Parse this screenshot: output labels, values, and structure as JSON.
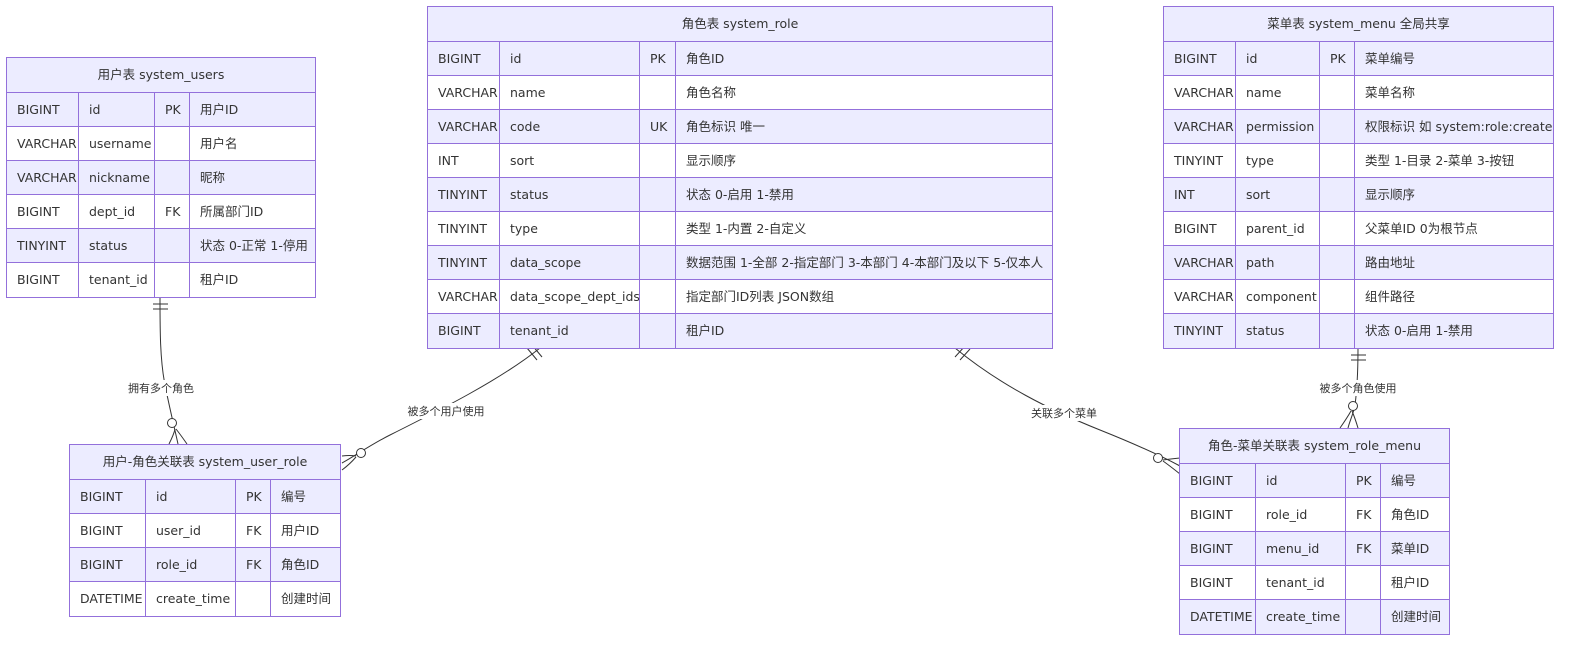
{
  "colors": {
    "border": "#9370db",
    "header_bg": "#ececff",
    "row_alt_bg": "#ececff",
    "line": "#333333"
  },
  "entities": {
    "system_users": {
      "title": "用户表 system_users",
      "rows": [
        {
          "type": "BIGINT",
          "name": "id",
          "key": "PK",
          "comment": "用户ID"
        },
        {
          "type": "VARCHAR",
          "name": "username",
          "key": "",
          "comment": "用户名"
        },
        {
          "type": "VARCHAR",
          "name": "nickname",
          "key": "",
          "comment": "昵称"
        },
        {
          "type": "BIGINT",
          "name": "dept_id",
          "key": "FK",
          "comment": "所属部门ID"
        },
        {
          "type": "TINYINT",
          "name": "status",
          "key": "",
          "comment": "状态 0-正常 1-停用"
        },
        {
          "type": "BIGINT",
          "name": "tenant_id",
          "key": "",
          "comment": "租户ID"
        }
      ]
    },
    "system_role": {
      "title": "角色表 system_role",
      "rows": [
        {
          "type": "BIGINT",
          "name": "id",
          "key": "PK",
          "comment": "角色ID"
        },
        {
          "type": "VARCHAR",
          "name": "name",
          "key": "",
          "comment": "角色名称"
        },
        {
          "type": "VARCHAR",
          "name": "code",
          "key": "UK",
          "comment": "角色标识 唯一"
        },
        {
          "type": "INT",
          "name": "sort",
          "key": "",
          "comment": "显示顺序"
        },
        {
          "type": "TINYINT",
          "name": "status",
          "key": "",
          "comment": "状态 0-启用 1-禁用"
        },
        {
          "type": "TINYINT",
          "name": "type",
          "key": "",
          "comment": "类型 1-内置 2-自定义"
        },
        {
          "type": "TINYINT",
          "name": "data_scope",
          "key": "",
          "comment": "数据范围 1-全部 2-指定部门 3-本部门 4-本部门及以下 5-仅本人"
        },
        {
          "type": "VARCHAR",
          "name": "data_scope_dept_ids",
          "key": "",
          "comment": "指定部门ID列表 JSON数组"
        },
        {
          "type": "BIGINT",
          "name": "tenant_id",
          "key": "",
          "comment": "租户ID"
        }
      ]
    },
    "system_menu": {
      "title": "菜单表 system_menu 全局共享",
      "rows": [
        {
          "type": "BIGINT",
          "name": "id",
          "key": "PK",
          "comment": "菜单编号"
        },
        {
          "type": "VARCHAR",
          "name": "name",
          "key": "",
          "comment": "菜单名称"
        },
        {
          "type": "VARCHAR",
          "name": "permission",
          "key": "",
          "comment": "权限标识 如 system:role:create"
        },
        {
          "type": "TINYINT",
          "name": "type",
          "key": "",
          "comment": "类型 1-目录 2-菜单 3-按钮"
        },
        {
          "type": "INT",
          "name": "sort",
          "key": "",
          "comment": "显示顺序"
        },
        {
          "type": "BIGINT",
          "name": "parent_id",
          "key": "",
          "comment": "父菜单ID 0为根节点"
        },
        {
          "type": "VARCHAR",
          "name": "path",
          "key": "",
          "comment": "路由地址"
        },
        {
          "type": "VARCHAR",
          "name": "component",
          "key": "",
          "comment": "组件路径"
        },
        {
          "type": "TINYINT",
          "name": "status",
          "key": "",
          "comment": "状态 0-启用 1-禁用"
        }
      ]
    },
    "system_user_role": {
      "title": "用户-角色关联表 system_user_role",
      "rows": [
        {
          "type": "BIGINT",
          "name": "id",
          "key": "PK",
          "comment": "编号"
        },
        {
          "type": "BIGINT",
          "name": "user_id",
          "key": "FK",
          "comment": "用户ID"
        },
        {
          "type": "BIGINT",
          "name": "role_id",
          "key": "FK",
          "comment": "角色ID"
        },
        {
          "type": "DATETIME",
          "name": "create_time",
          "key": "",
          "comment": "创建时间"
        }
      ]
    },
    "system_role_menu": {
      "title": "角色-菜单关联表 system_role_menu",
      "rows": [
        {
          "type": "BIGINT",
          "name": "id",
          "key": "PK",
          "comment": "编号"
        },
        {
          "type": "BIGINT",
          "name": "role_id",
          "key": "FK",
          "comment": "角色ID"
        },
        {
          "type": "BIGINT",
          "name": "menu_id",
          "key": "FK",
          "comment": "菜单ID"
        },
        {
          "type": "BIGINT",
          "name": "tenant_id",
          "key": "",
          "comment": "租户ID"
        },
        {
          "type": "DATETIME",
          "name": "create_time",
          "key": "",
          "comment": "创建时间"
        }
      ]
    }
  },
  "relationships": [
    {
      "from": "system_users",
      "to": "system_user_role",
      "label": "拥有多个角色",
      "cardinality": "one-to-many"
    },
    {
      "from": "system_role",
      "to": "system_user_role",
      "label": "被多个用户使用",
      "cardinality": "one-to-many"
    },
    {
      "from": "system_role",
      "to": "system_role_menu",
      "label": "关联多个菜单",
      "cardinality": "one-to-many"
    },
    {
      "from": "system_menu",
      "to": "system_role_menu",
      "label": "被多个角色使用",
      "cardinality": "one-to-many"
    }
  ]
}
